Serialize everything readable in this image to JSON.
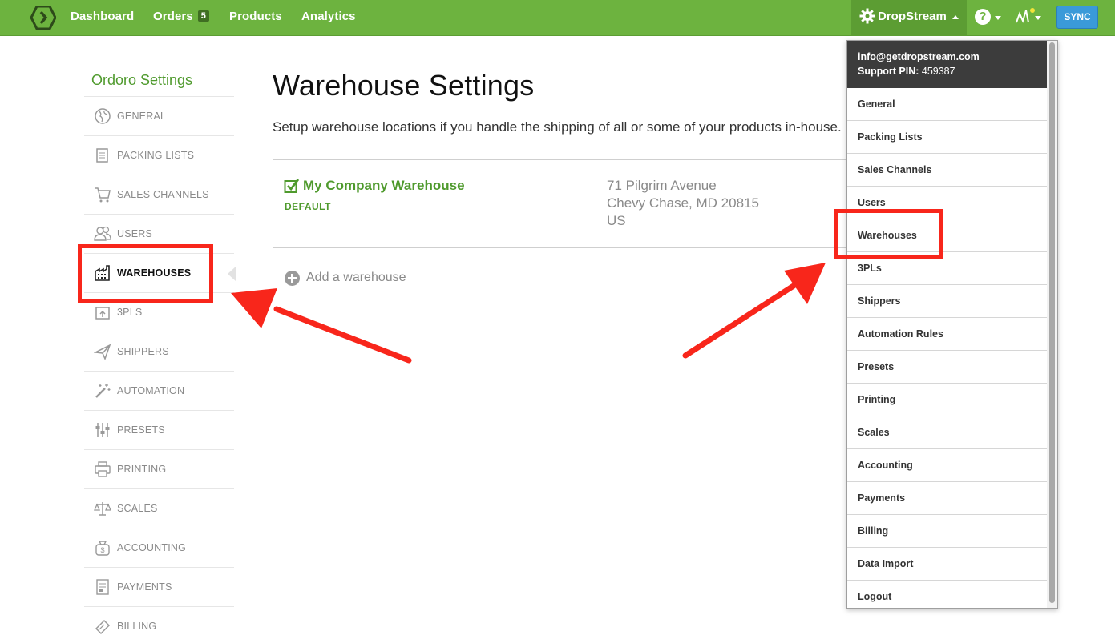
{
  "nav": {
    "dashboard": "Dashboard",
    "orders": "Orders",
    "orders_count": "5",
    "products": "Products",
    "analytics": "Analytics",
    "account_name": "DropStream",
    "sync": "SYNC",
    "help_glyph": "?"
  },
  "sidebar": {
    "title": "Ordoro Settings",
    "items": [
      {
        "label": "GENERAL",
        "icon": "globe-icon"
      },
      {
        "label": "PACKING LISTS",
        "icon": "document-icon"
      },
      {
        "label": "SALES CHANNELS",
        "icon": "cart-icon"
      },
      {
        "label": "USERS",
        "icon": "users-icon"
      },
      {
        "label": "WAREHOUSES",
        "icon": "warehouse-icon",
        "active": true
      },
      {
        "label": "3PLS",
        "icon": "box-icon"
      },
      {
        "label": "SHIPPERS",
        "icon": "plane-icon"
      },
      {
        "label": "AUTOMATION",
        "icon": "wand-icon"
      },
      {
        "label": "PRESETS",
        "icon": "sliders-icon"
      },
      {
        "label": "PRINTING",
        "icon": "printer-icon"
      },
      {
        "label": "SCALES",
        "icon": "scale-icon"
      },
      {
        "label": "ACCOUNTING",
        "icon": "money-bag-icon"
      },
      {
        "label": "PAYMENTS",
        "icon": "receipt-icon"
      },
      {
        "label": "BILLING",
        "icon": "tag-icon"
      }
    ]
  },
  "main": {
    "title": "Warehouse Settings",
    "description": "Setup warehouse locations if you handle the shipping of all or some of your products in-house.",
    "warehouse": {
      "name": "My Company Warehouse",
      "badge": "DEFAULT",
      "address_line1": "71 Pilgrim Avenue",
      "address_line2": "Chevy Chase, MD 20815",
      "address_line3": "US"
    },
    "add_warehouse": "Add a warehouse"
  },
  "dropdown": {
    "email": "info@getdropstream.com",
    "pin_label": "Support PIN:",
    "pin_value": "459387",
    "items": [
      "General",
      "Packing Lists",
      "Sales Channels",
      "Users",
      "Warehouses",
      "3PLs",
      "Shippers",
      "Automation Rules",
      "Presets",
      "Printing",
      "Scales",
      "Accounting",
      "Payments",
      "Billing",
      "Data Import",
      "Logout"
    ]
  },
  "colors": {
    "brand_green": "#6db33f",
    "text_green": "#4f9a2d",
    "sync_blue": "#3a9ad9",
    "annotation_red": "#f8261b"
  }
}
